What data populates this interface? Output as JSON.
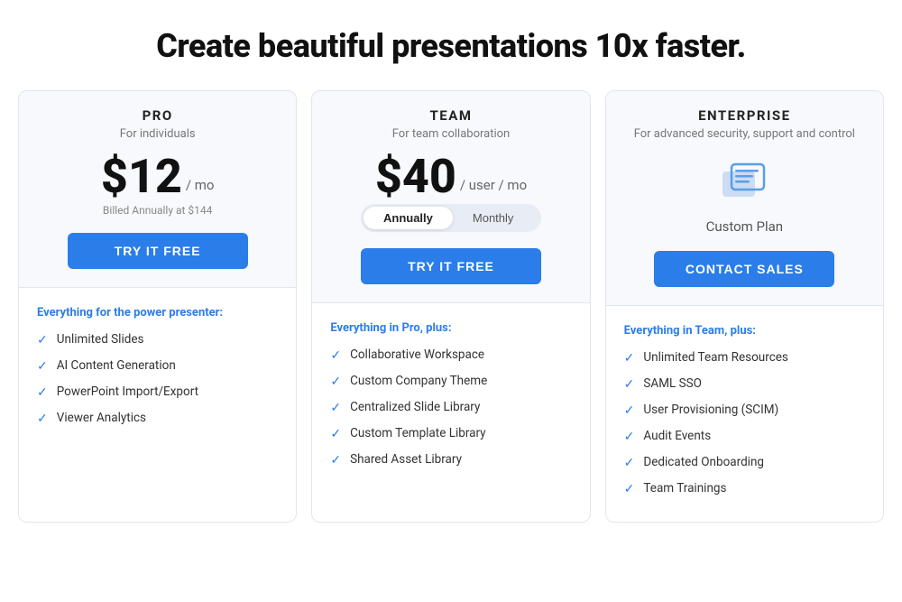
{
  "page": {
    "title": "Create beautiful presentations 10x faster."
  },
  "plans": [
    {
      "id": "pro",
      "name": "PRO",
      "subtitle": "For individuals",
      "price": "$12",
      "period": "/ mo",
      "billed": "Billed Annually at $144",
      "cta_label": "TRY IT FREE",
      "features_heading": "Everything for the power presenter:",
      "features": [
        "Unlimited Slides",
        "AI Content Generation",
        "PowerPoint Import/Export",
        "Viewer Analytics"
      ]
    },
    {
      "id": "team",
      "name": "TEAM",
      "subtitle": "For team collaboration",
      "price": "$40",
      "period": "/ user / mo",
      "toggle": {
        "option1": "Annually",
        "option2": "Monthly",
        "active": "Annually"
      },
      "cta_label": "TRY IT FREE",
      "features_heading": "Everything in Pro, plus:",
      "features": [
        "Collaborative Workspace",
        "Custom Company Theme",
        "Centralized Slide Library",
        "Custom Template Library",
        "Shared Asset Library"
      ]
    },
    {
      "id": "enterprise",
      "name": "ENTERPRISE",
      "subtitle": "For advanced security, support and control",
      "custom_label": "Custom Plan",
      "cta_label": "CONTACT SALES",
      "features_heading": "Everything in Team, plus:",
      "features": [
        "Unlimited Team Resources",
        "SAML SSO",
        "User Provisioning (SCIM)",
        "Audit Events",
        "Dedicated Onboarding",
        "Team Trainings"
      ]
    }
  ]
}
